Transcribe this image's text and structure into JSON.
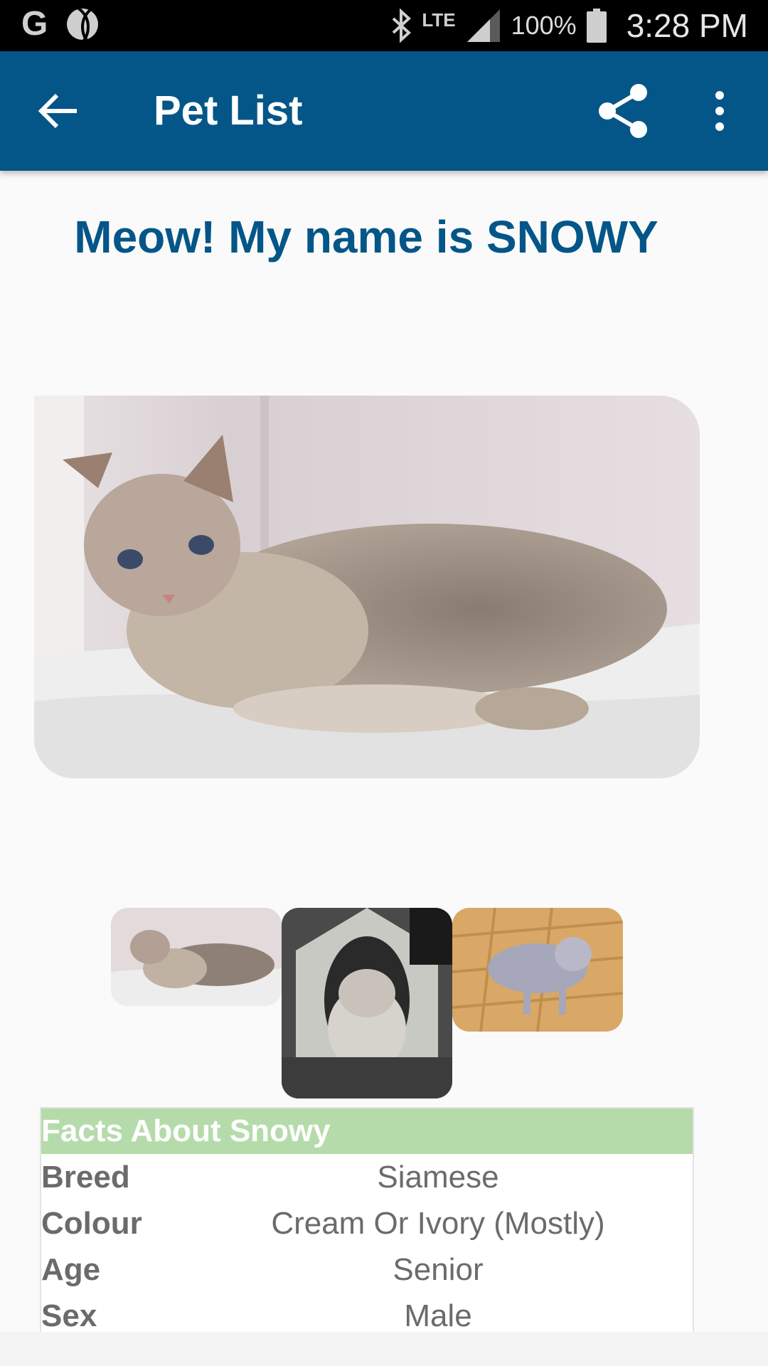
{
  "status_bar": {
    "left_icons": [
      "google-icon",
      "sports-ball-icon"
    ],
    "lte_label": "LTE",
    "battery_percent": "100%",
    "time": "3:28 PM"
  },
  "app_bar": {
    "title": "Pet List",
    "icons": [
      "back-arrow-icon",
      "share-icon",
      "more-vert-icon"
    ],
    "color": "#045688"
  },
  "headline": "Meow! My name is SNOWY",
  "gallery": {
    "thumbnails": [
      "snowy-photo-1",
      "snowy-photo-2",
      "snowy-photo-3"
    ]
  },
  "facts": {
    "header": "Facts About Snowy",
    "header_color": "#b5dbab",
    "rows": [
      {
        "label": "Breed",
        "value": "Siamese"
      },
      {
        "label": "Colour",
        "value": "Cream Or Ivory (Mostly)"
      },
      {
        "label": "Age",
        "value": "Senior"
      },
      {
        "label": "Sex",
        "value": "Male"
      }
    ]
  }
}
